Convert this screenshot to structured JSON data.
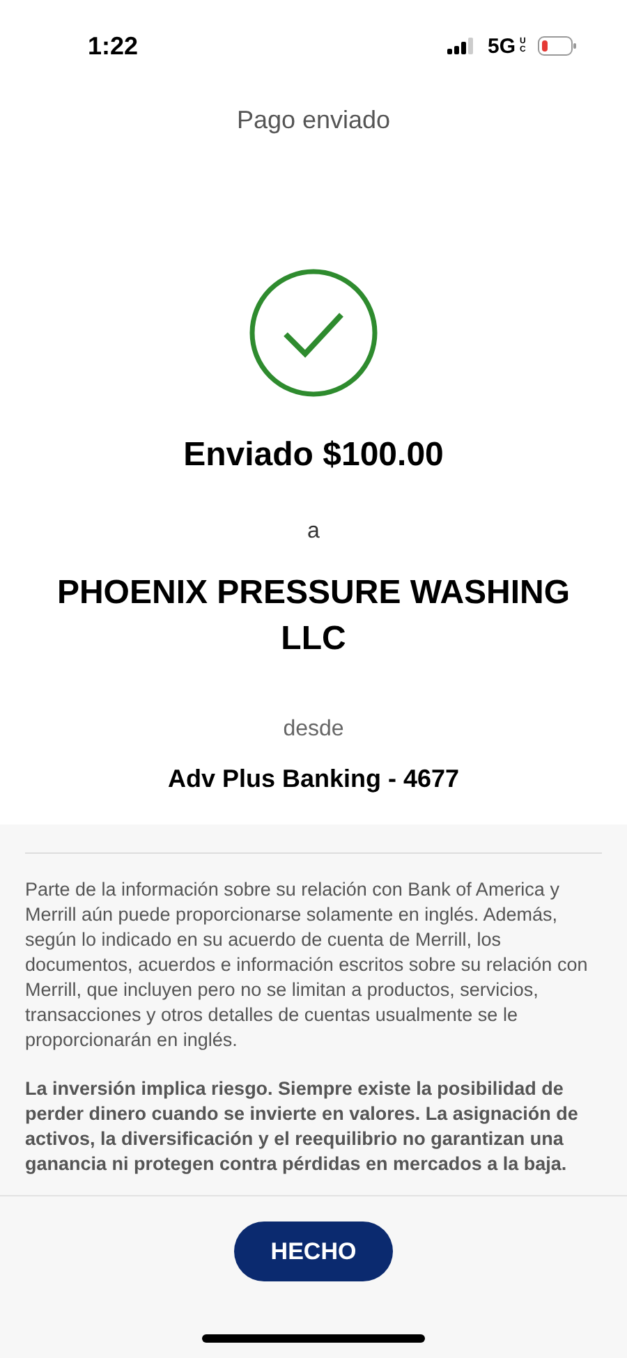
{
  "status_bar": {
    "time": "1:22",
    "network": "5G",
    "network_badge": "UC"
  },
  "header": {
    "title": "Pago enviado"
  },
  "confirmation": {
    "amount_line": "Enviado $100.00",
    "to_label": "a",
    "payee": "PHOENIX PRESSURE WASHING LLC",
    "from_label": "desde",
    "account": "Adv Plus Banking - 4677"
  },
  "disclosures": [
    {
      "kind": "plain",
      "text": "Parte de la información sobre su relación con Bank of America y Merrill aún puede proporcionarse solamente en inglés. Además, según lo indicado en su acuerdo de cuenta de Merrill, los documentos, acuerdos e información escritos sobre su relación con Merrill, que incluyen pero no se limitan a productos, servicios, transacciones y otros detalles de cuentas usualmente se le proporcionarán en inglés."
    },
    {
      "kind": "bold",
      "text": "La inversión implica riesgo. Siempre existe la posibilidad de perder dinero cuando se invierte en valores. La asignación de activos, la diversificación y el reequilibrio no garantizan una ganancia ni protegen contra pérdidas en mercados a la baja."
    }
  ],
  "footer": {
    "button": "HECHO"
  }
}
